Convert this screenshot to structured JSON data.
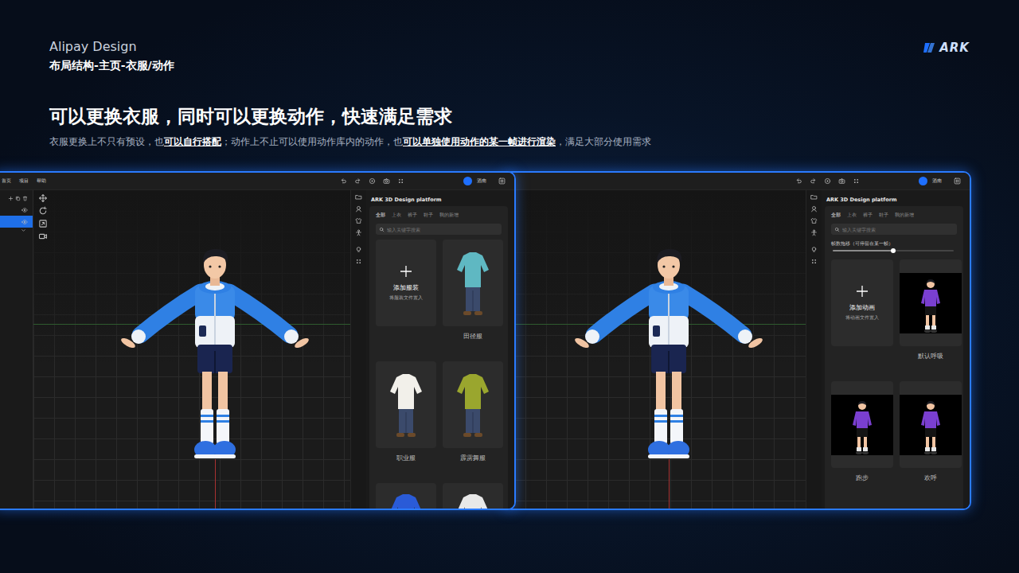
{
  "header": {
    "brand": "Alipay Design",
    "section": "布局结构-主页-衣服/动作",
    "logo": "ARK"
  },
  "headline": "可以更换衣服，同时可以更换动作，快速满足需求",
  "description": [
    {
      "text": "衣服更换上不只有预设，也",
      "emphasis": false
    },
    {
      "text": "可以自行搭配",
      "emphasis": true
    },
    {
      "text": "；动作上不止可以使用动作库内的动作，也",
      "emphasis": false
    },
    {
      "text": "可以单独使用动作的某一帧进行渲染",
      "emphasis": true
    },
    {
      "text": "，满足大部分使用需求",
      "emphasis": false
    }
  ],
  "windows": [
    {
      "menu": [
        "首页",
        "项目",
        "帮助"
      ],
      "layers": [
        {
          "selected": false
        },
        {
          "selected": true
        }
      ],
      "user": "酒南",
      "panel": {
        "title": "ARK 3D Design platform",
        "tabs": [
          {
            "label": "全部",
            "selected": true
          },
          {
            "label": "上衣",
            "selected": false
          },
          {
            "label": "裤子",
            "selected": false
          },
          {
            "label": "鞋子",
            "selected": false
          },
          {
            "label": "我的新增",
            "selected": false
          }
        ],
        "search": {
          "placeholder": "输入关键字搜索"
        },
        "add_card": {
          "title": "添加服装",
          "hint": "将服装文件置入"
        },
        "items": [
          {
            "label": "田径服",
            "kind": "outfit",
            "color": "#5fb8c2"
          },
          {
            "label": "职业服",
            "kind": "outfit",
            "color": "#f2f0ea"
          },
          {
            "label": "霹雳舞服",
            "kind": "outfit",
            "color": "#9aa62e"
          },
          {
            "kind": "outfit-cut",
            "color": "#2a5bd7"
          },
          {
            "kind": "outfit-cut",
            "color": "#e8e8e8"
          }
        ]
      }
    },
    {
      "menu": [],
      "user": "酒南",
      "panel": {
        "title": "ARK 3D Design platform",
        "tabs": [
          {
            "label": "全部",
            "selected": true
          },
          {
            "label": "上衣",
            "selected": false
          },
          {
            "label": "裤子",
            "selected": false
          },
          {
            "label": "鞋子",
            "selected": false
          },
          {
            "label": "我的新增",
            "selected": false
          }
        ],
        "search": {
          "placeholder": "输入关键字搜索"
        },
        "slider": {
          "label": "帧数拖移（可停留在某一帧）",
          "level": 0.5
        },
        "add_card": {
          "title": "添加动画",
          "hint": "将动画文件置入"
        },
        "items": [
          {
            "label": "默认呼吸",
            "kind": "motion"
          },
          {
            "label": "跑步",
            "kind": "motion"
          },
          {
            "label": "欢呼",
            "kind": "motion"
          }
        ]
      }
    }
  ]
}
